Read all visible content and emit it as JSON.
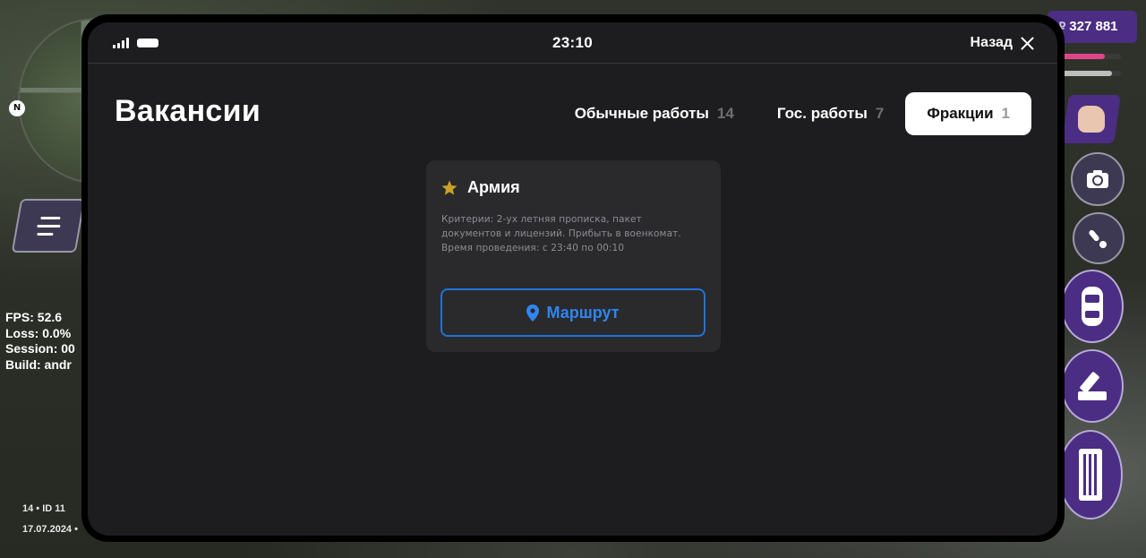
{
  "hud": {
    "debug": {
      "fps": "FPS: 52.6",
      "loss": "Loss: 0.0%",
      "session": "Session: 00",
      "build": "Build: andr"
    },
    "player_line": "14 • ID 11",
    "date_line": "17.07.2024 •",
    "north": "N",
    "currency_symbol": "₽",
    "money": "327 881",
    "health_fraction": 0.72,
    "armor_fraction": 0.85
  },
  "phone": {
    "time": "23:10",
    "back_label": "Назад"
  },
  "page": {
    "title": "Вакансии",
    "tabs": [
      {
        "label": "Обычные работы",
        "count": "14",
        "active": false
      },
      {
        "label": "Гос. работы",
        "count": "7",
        "active": false
      },
      {
        "label": "Фракции",
        "count": "1",
        "active": true
      }
    ]
  },
  "jobs": [
    {
      "title": "Армия",
      "description_lines": [
        "Критерии: 2-ух летняя прописка, пакет",
        "документов и лицензий. Прибыть в военкомат.",
        "Время проведения: с 23:40 по 00:10"
      ],
      "route_label": "Маршрут"
    }
  ],
  "colors": {
    "accent_blue": "#2f86ef",
    "star_gold": "#c9a227",
    "hud_purple": "#4b2d83",
    "screen_bg": "#1d1d1f",
    "card_bg": "#2a2a2d"
  }
}
